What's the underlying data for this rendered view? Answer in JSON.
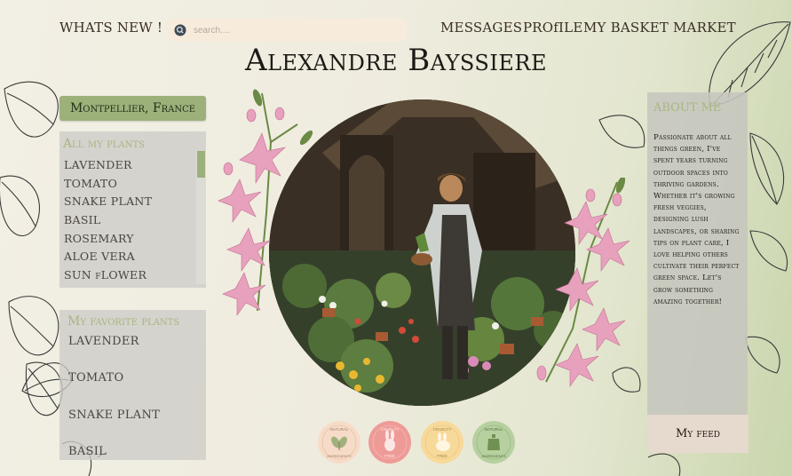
{
  "header": {
    "whats_new": "WHATS NEW !",
    "search_placeholder": "search....",
    "nav": {
      "messages": "MESSAGES",
      "profile": "PROfILE",
      "basket": "MY BASKET",
      "market": "MARKET"
    },
    "name": "Alexandre Bayssiere"
  },
  "location": "Montpellier, France",
  "all_plants": {
    "title": "All my  plants",
    "items": [
      "LAVENDER",
      "TOMATO",
      "SNAKE PLANT",
      "BASIL",
      "ROSEMARY",
      "ALOE VERA",
      "SUN fLOWER"
    ]
  },
  "favorite_plants": {
    "title": "My favorite plants",
    "items": [
      "LAVENDER",
      "TOMATO",
      "SNAKE PLANT",
      "BASIL"
    ]
  },
  "about": {
    "title": "ABOUT ME",
    "text": "Passionate about all things green, I've spent years turning outdoor spaces into thriving gardens. Whether it's growing fresh veggies, designing lush landscapes, or sharing tips on plant care, I love helping others cultivate their perfect green space. Let's grow something amazing together!"
  },
  "feed_button": "My feed",
  "badges": [
    {
      "top": "NATURAL",
      "bottom": "INGREDIENTS",
      "color": "#f6dcc8",
      "icon": "leaf-icon"
    },
    {
      "top": "CRUELTY",
      "bottom": "FREE",
      "color": "#ee9b97",
      "icon": "rabbit-icon"
    },
    {
      "top": "CRUELTY",
      "bottom": "FREE",
      "color": "#f7d99a",
      "icon": "rabbit-icon"
    },
    {
      "top": "NATURAL",
      "bottom": "INGREDIENTS",
      "color": "#b7d0a0",
      "icon": "bottle-icon"
    }
  ],
  "colors": {
    "accent": "#9cb07a",
    "panel": "#cdccc6",
    "text": "#3a2e25"
  }
}
